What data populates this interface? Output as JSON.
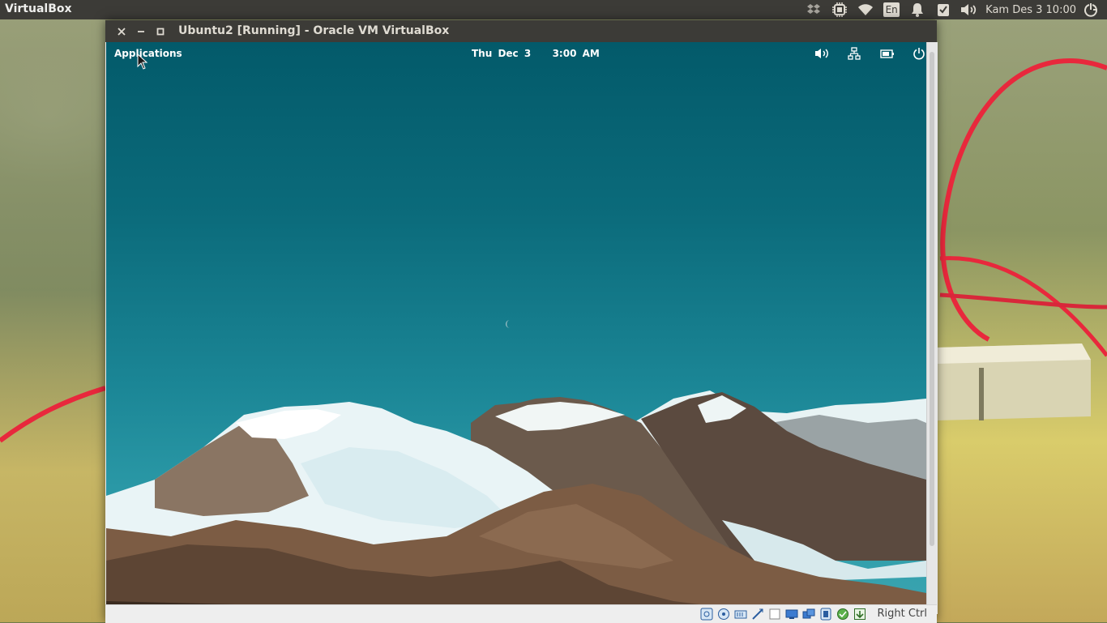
{
  "host_panel": {
    "app_name": "VirtualBox",
    "indicators": [
      {
        "name": "dropbox-icon"
      },
      {
        "name": "cpu-icon"
      },
      {
        "name": "wifi-icon"
      },
      {
        "name": "keyboard-language",
        "label": "En"
      },
      {
        "name": "notification-bell-icon"
      },
      {
        "name": "checklist-icon"
      },
      {
        "name": "volume-icon"
      }
    ],
    "clock": "Kam Des  3 10:00",
    "session_icon": "power-settings-icon"
  },
  "vm_window": {
    "title": "Ubuntu2 [Running] - Oracle VM VirtualBox",
    "buttons": [
      "close",
      "minimize",
      "maximize"
    ]
  },
  "guest": {
    "applications_label": "Applications",
    "date": "Thu Dec  3",
    "time": "3:00 AM",
    "indicators": [
      "volume-icon",
      "network-icon",
      "battery-icon",
      "power-icon"
    ]
  },
  "statusbar": {
    "icons": [
      "hard-disk-icon",
      "optical-drive-icon",
      "audio-icon",
      "network-icon",
      "usb-icon",
      "shared-folders-icon",
      "display-icon",
      "video-capture-icon",
      "cpu-virtualization-icon",
      "mouse-integration-icon",
      "keyboard-capture-icon"
    ],
    "host_key": "Right Ctrl"
  },
  "colors": {
    "panel": "#3c3b37",
    "sky_top": "#035a6a",
    "sky_bottom": "#3ba5b1",
    "accent_red": "#e8283c"
  }
}
